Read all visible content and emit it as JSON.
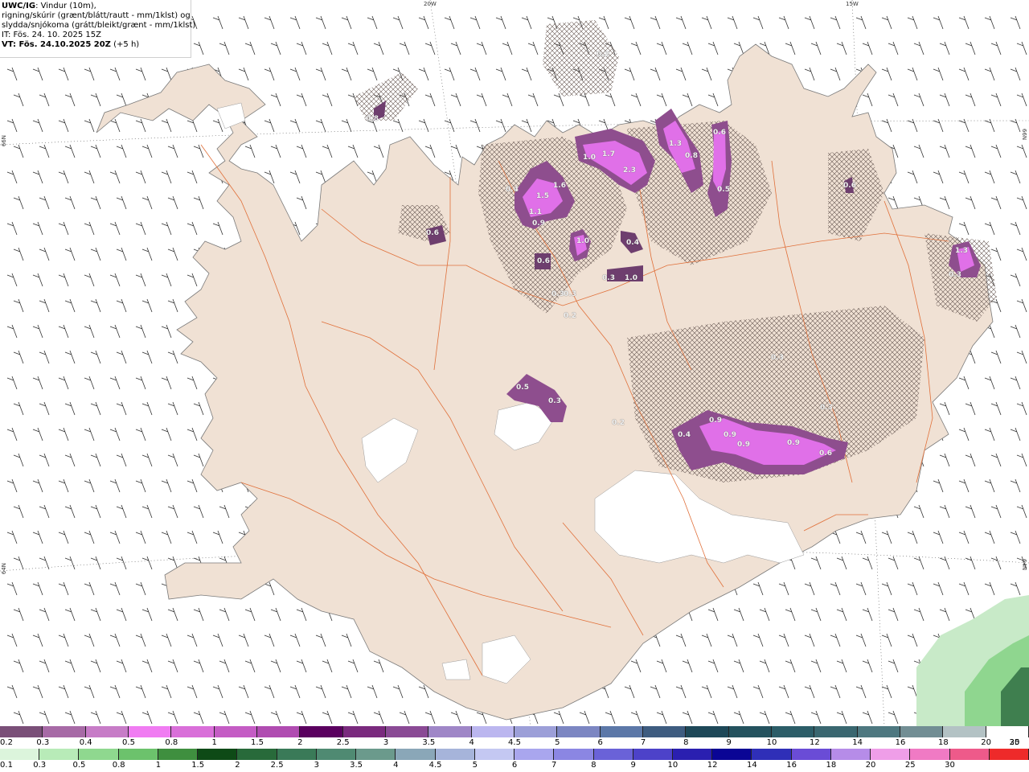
{
  "info": {
    "title": "UWC/IG",
    "line1": ": Vindur (10m),",
    "line2": "rigning/skúrir (grænt/blátt/rautt - mm/1klst) og",
    "line3": "slydda/snjókoma (grátt/bleikt/grænt - mm/1klst)",
    "issue": "IT: Fös. 24. 10. 2025 15Z",
    "valid_prefix": "VT: Fös. 24.10.2025 20Z",
    "valid_suffix": " (+5 h)"
  },
  "coords": {
    "top_20w": "20W",
    "top_15w": "15W",
    "left_66n": "66N",
    "right_66n": "66N",
    "left_64n": "64N",
    "right_64n": "64N"
  },
  "precip_labels": [
    {
      "t": "0.2"
    },
    {
      "t": "0.8"
    },
    {
      "t": "0.6"
    },
    {
      "t": "1.0"
    },
    {
      "t": "1.7"
    },
    {
      "t": "2.3"
    },
    {
      "t": "1.3"
    },
    {
      "t": "0.8"
    },
    {
      "t": "0.6"
    },
    {
      "t": "0.5"
    },
    {
      "t": "0.4"
    },
    {
      "t": "1.6"
    },
    {
      "t": "1.5"
    },
    {
      "t": "1.1"
    },
    {
      "t": "0.9"
    },
    {
      "t": "0.6"
    },
    {
      "t": "1.0"
    },
    {
      "t": "0.4"
    },
    {
      "t": "0.6"
    },
    {
      "t": "0.3"
    },
    {
      "t": "1.0"
    },
    {
      "t": "0.3"
    },
    {
      "t": "0.3"
    },
    {
      "t": "0.2"
    },
    {
      "t": "1.3"
    },
    {
      "t": "0.3"
    },
    {
      "t": "0.3"
    },
    {
      "t": "0.5"
    },
    {
      "t": "0.3"
    },
    {
      "t": "0.3"
    },
    {
      "t": "0.9"
    },
    {
      "t": "0.4"
    },
    {
      "t": "0.9"
    },
    {
      "t": "0.9"
    },
    {
      "t": "0.9"
    },
    {
      "t": "0.6"
    },
    {
      "t": "0.2"
    }
  ],
  "legend": {
    "snow_colors": [
      "#7a4f78",
      "#a76aa6",
      "#c77cc7",
      "#f07cf2",
      "#d96fd9",
      "#c45cc4",
      "#b04cb1",
      "#5a005f",
      "#7a2a7e",
      "#8a4a95",
      "#9f86c7",
      "#bbb6ef",
      "#9c9fd8",
      "#7c86c2",
      "#5c78a8",
      "#3e5c80",
      "#1e4858",
      "#24525e",
      "#2c5d68",
      "#3a6770",
      "#4e7880",
      "#728e94",
      "#b3c2c4",
      "#ffffff"
    ],
    "snow_labels": [
      "0.2",
      "0.3",
      "0.4",
      "0.5",
      "0.8",
      "1",
      "1.5",
      "2",
      "2.5",
      "3",
      "3.5",
      "4",
      "4.5",
      "5",
      "6",
      "7",
      "8",
      "9",
      "10",
      "12",
      "14",
      "16",
      "18",
      "20",
      "25",
      "30"
    ],
    "rain_colors": [
      "#dcf5dc",
      "#b8ebb8",
      "#8fd88f",
      "#6cc26c",
      "#3f8f3f",
      "#0e4a16",
      "#286a3a",
      "#3a7a58",
      "#4f8a72",
      "#6b9a8c",
      "#8aa7b8",
      "#a6b4da",
      "#c4c8f2",
      "#a9a6ee",
      "#8b86e3",
      "#6a62d8",
      "#4d42c9",
      "#2a1fb0",
      "#0a0595",
      "#2f2fb8",
      "#6a4cd6",
      "#b68ce8",
      "#ef9ee8",
      "#f07ac4",
      "#ee5a8a",
      "#ee2a2a"
    ],
    "rain_labels": [
      "0.1",
      "0.3",
      "0.5",
      "0.8",
      "1",
      "1.5",
      "2",
      "2.5",
      "3",
      "3.5",
      "4",
      "4.5",
      "5",
      "6",
      "7",
      "8",
      "9",
      "10",
      "12",
      "14",
      "16",
      "18",
      "20",
      "25",
      "30"
    ]
  }
}
